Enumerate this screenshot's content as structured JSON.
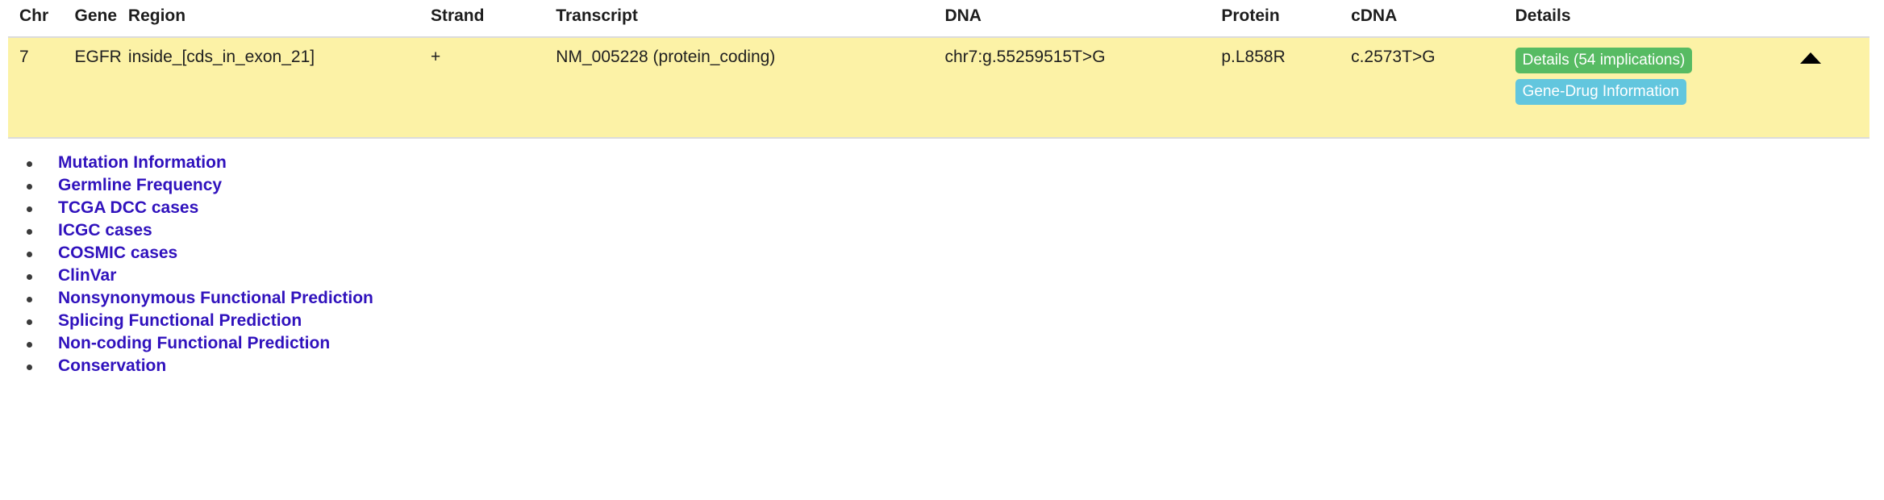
{
  "table": {
    "columns": [
      {
        "key": "chr",
        "label": "Chr"
      },
      {
        "key": "gene",
        "label": "Gene"
      },
      {
        "key": "region",
        "label": "Region"
      },
      {
        "key": "strand",
        "label": "Strand"
      },
      {
        "key": "transcript",
        "label": "Transcript"
      },
      {
        "key": "dna",
        "label": "DNA"
      },
      {
        "key": "protein",
        "label": "Protein"
      },
      {
        "key": "cdna",
        "label": "cDNA"
      },
      {
        "key": "details",
        "label": "Details"
      }
    ],
    "row": {
      "chr": "7",
      "gene": "EGFR",
      "region": "inside_[cds_in_exon_21]",
      "strand": "+",
      "transcript": "NM_005228 (protein_coding)",
      "dna": "chr7:g.55259515T>G",
      "protein": "p.L858R",
      "cdna": "c.2573T>G",
      "highlight_color": "#fcf2a6",
      "badges": [
        {
          "label": "Details (54 implications)",
          "color": "#57bb63",
          "name": "details-badge"
        },
        {
          "label": "Gene-Drug Information",
          "color": "#62c6de",
          "name": "gene-drug-badge"
        }
      ],
      "toggle": {
        "icon": "caret-up-icon",
        "state": "expanded"
      }
    }
  },
  "detail_links": [
    {
      "label": "Mutation Information"
    },
    {
      "label": "Germline Frequency"
    },
    {
      "label": "TCGA DCC cases"
    },
    {
      "label": "ICGC cases"
    },
    {
      "label": "COSMIC cases"
    },
    {
      "label": "ClinVar"
    },
    {
      "label": "Nonsynonymous Functional Prediction"
    },
    {
      "label": "Splicing Functional Prediction"
    },
    {
      "label": "Non-coding Functional Prediction"
    },
    {
      "label": "Conservation"
    }
  ],
  "colors": {
    "link": "#3012bd",
    "row_highlight": "#fcf2a6",
    "row_border": "#dcdcdc"
  }
}
